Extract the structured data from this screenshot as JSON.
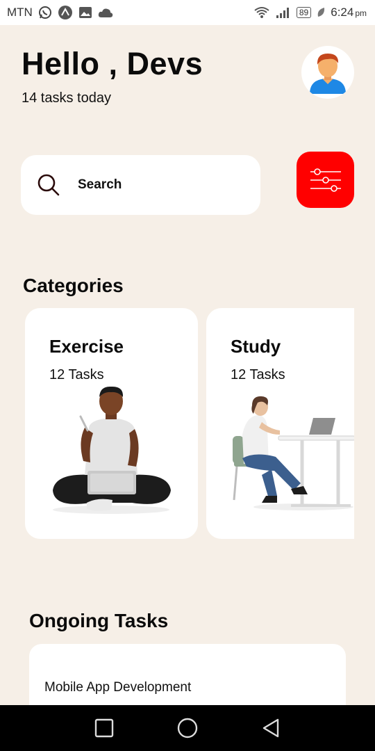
{
  "status_bar": {
    "carrier": "MTN",
    "battery": "89",
    "time": "6:24",
    "ampm": "pm"
  },
  "header": {
    "greeting": "Hello , Devs",
    "subtitle": "14 tasks today"
  },
  "search": {
    "placeholder": "Search"
  },
  "categories": {
    "title": "Categories",
    "items": [
      {
        "title": "Exercise",
        "count": "12 Tasks"
      },
      {
        "title": "Study",
        "count": "12 Tasks"
      }
    ]
  },
  "ongoing": {
    "title": "Ongoing Tasks",
    "items": [
      {
        "name": "Mobile App Development"
      }
    ]
  },
  "colors": {
    "background": "#f6efe7",
    "accent": "#ff0000",
    "card": "#ffffff"
  },
  "icons": [
    "whatsapp-icon",
    "app-icon",
    "image-icon",
    "cloud-icon",
    "wifi-icon",
    "signal-icon",
    "battery-icon",
    "leaf-icon",
    "search-icon",
    "filter-sliders-icon",
    "nav-recents-icon",
    "nav-home-icon",
    "nav-back-icon"
  ]
}
